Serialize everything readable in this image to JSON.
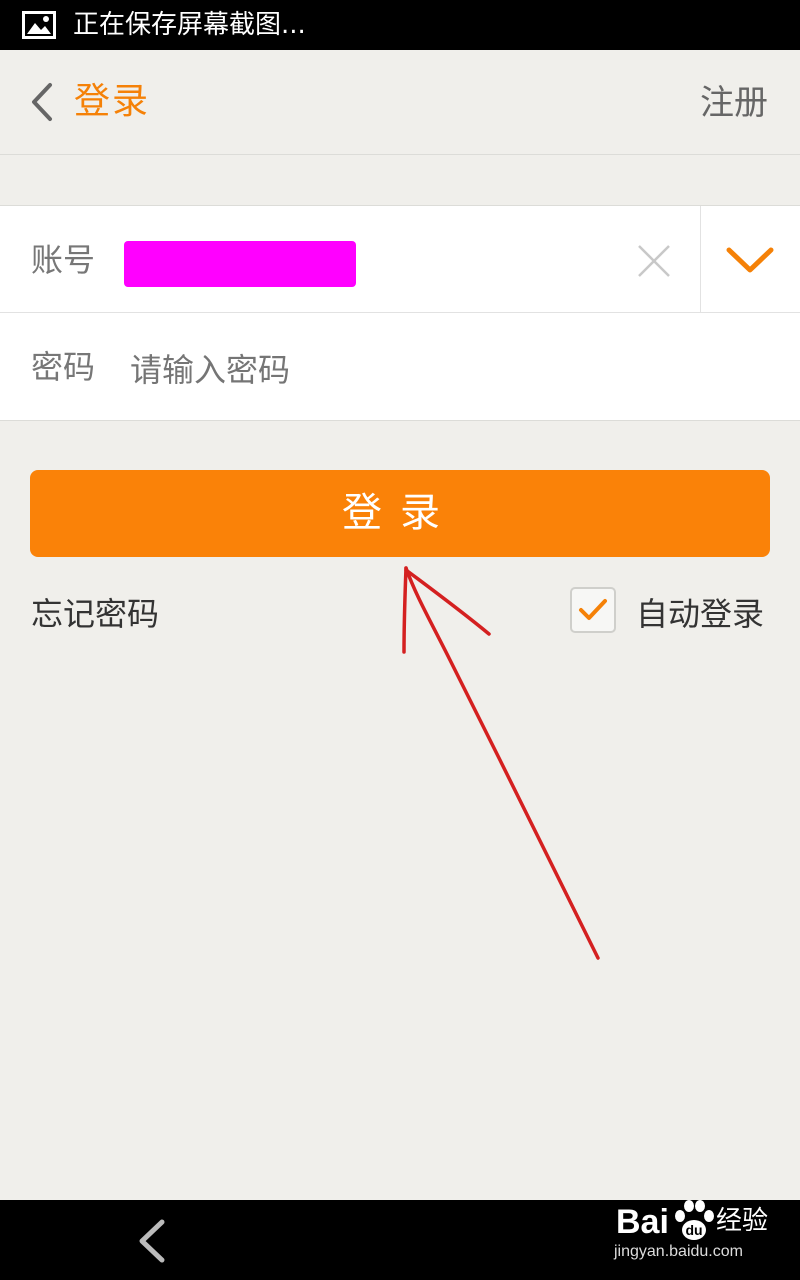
{
  "status_bar": {
    "notification_text": "正在保存屏幕截图...",
    "icon": "image-icon"
  },
  "header": {
    "title": "登录",
    "register_label": "注册",
    "back_icon": "chevron-left-icon"
  },
  "form": {
    "account_label": "账号",
    "password_label": "密码",
    "password_placeholder": "请输入密码",
    "clear_icon": "close-icon",
    "dropdown_icon": "chevron-down-icon"
  },
  "actions": {
    "login_button_label": "登录",
    "forgot_password_label": "忘记密码",
    "auto_login_label": "自动登录",
    "auto_login_checked": true
  },
  "navigation": {
    "back_icon": "nav-back-icon"
  },
  "watermark": {
    "brand": "Bai",
    "product": "经验",
    "url": "jingyan.baidu.com"
  },
  "colors": {
    "accent": "#fa8208",
    "background": "#f0efeb",
    "redaction": "#ff00ff",
    "annotation_arrow": "#d42020"
  }
}
